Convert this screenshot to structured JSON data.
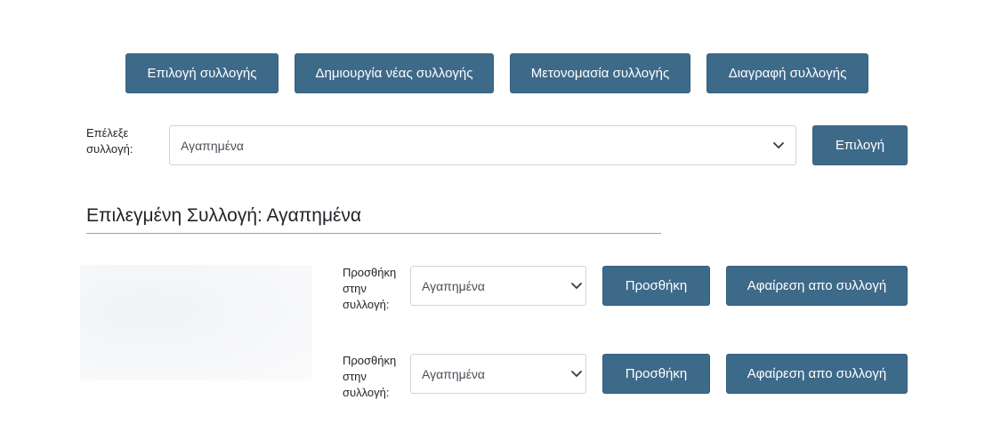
{
  "toolbar": {
    "select_collection": "Επιλογή συλλογής",
    "create_collection": "Δημιουργία νέας συλλογής",
    "rename_collection": "Μετονομασία συλλογής",
    "delete_collection": "Διαγραφή συλλογής"
  },
  "picker": {
    "label": "Επέλεξε συλλογή:",
    "selected": "Αγαπημένα",
    "submit": "Επιλογή"
  },
  "current": {
    "heading": "Επιλεγμένη Συλλογή: Αγαπημένα"
  },
  "items": [
    {
      "add_label": "Προσθήκη στην συλλογή:",
      "selected": "Αγαπημένα",
      "add_button": "Προσθήκη",
      "remove_button": "Αφαίρεση απο συλλογή"
    },
    {
      "add_label": "Προσθήκη στην συλλογή:",
      "selected": "Αγαπημένα",
      "add_button": "Προσθήκη",
      "remove_button": "Αφαίρεση απο συλλογή"
    }
  ],
  "icons": {
    "dropdown": "chevron-down-icon"
  },
  "colors": {
    "button_bg": "#3e6a8a",
    "button_text": "#ffffff"
  }
}
